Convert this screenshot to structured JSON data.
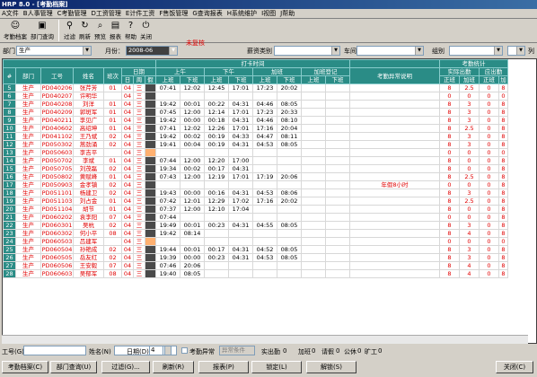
{
  "window": {
    "title": "HRP 8.0 - [考勤档案]"
  },
  "menu": [
    "A文件",
    "B人事管理",
    "C考勤管理",
    "D工资管理",
    "E计件工资",
    "F售饭管理",
    "G查询报表",
    "H系统维护",
    "I视图",
    "J帮助"
  ],
  "toolbar": [
    {
      "label": "考勤档案",
      "icon": "person-icon"
    },
    {
      "label": "部门查询",
      "icon": "computer-icon"
    },
    {
      "label": "过滤",
      "icon": "filter-icon"
    },
    {
      "label": "刷新",
      "icon": "refresh-icon"
    },
    {
      "label": "预览",
      "icon": "preview-icon"
    },
    {
      "label": "报表",
      "icon": "report-icon"
    },
    {
      "label": "帮助",
      "icon": "help-icon"
    },
    {
      "label": "关闭",
      "icon": "close-icon"
    }
  ],
  "status_flag": "未复核",
  "filter": {
    "dept_label": "部门",
    "dept_value": "生产",
    "month_label": "月份：",
    "month_value": "2008-06",
    "pay_type_label": "薪资类别",
    "workshop_label": "车间",
    "group_label": "组别",
    "col_label": "列"
  },
  "headers": {
    "punch": "打卡时间",
    "stats": "考勤统计",
    "num": "#",
    "dept": "部门",
    "emp_no": "工号",
    "name": "姓名",
    "shift": "班次",
    "date": "日期",
    "day": "日",
    "week": "周",
    "holiday": "假",
    "morning": "上午",
    "afternoon": "下午",
    "overtime": "加班",
    "ot_register": "加班登记",
    "abnormal": "考勤异常说明",
    "actual": "实际出勤",
    "due": "应出勤",
    "on_duty": "上班",
    "off_duty": "下班",
    "normal": "正班",
    "ot": "加班",
    "normal2": "正班",
    "ot2": "加"
  },
  "rows": [
    {
      "n": "5",
      "dept": "生产",
      "id": "PD040206",
      "name": "张芹芳",
      "shift": "01",
      "d": "04",
      "w": "三",
      "t": [
        "07:41",
        "12:02",
        "12:45",
        "17:01",
        "17:23",
        "20:02"
      ],
      "note": "",
      "s": [
        "8",
        "2.5",
        "0",
        "8"
      ]
    },
    {
      "n": "6",
      "dept": "生产",
      "id": "PD040207",
      "name": "许明华",
      "shift": "",
      "d": "04",
      "w": "三",
      "t": [
        "",
        "",
        "",
        "",
        "",
        ""
      ],
      "note": "",
      "s": [
        "0",
        "0",
        "0",
        "0"
      ]
    },
    {
      "n": "7",
      "dept": "生产",
      "id": "PD040208",
      "name": "刘洋",
      "shift": "01",
      "d": "04",
      "w": "三",
      "t": [
        "19:42",
        "00:01",
        "00:22",
        "04:31",
        "04:46",
        "08:05"
      ],
      "note": "",
      "s": [
        "8",
        "3",
        "0",
        "8"
      ]
    },
    {
      "n": "8",
      "dept": "生产",
      "id": "PD040209",
      "name": "郭斑军",
      "shift": "01",
      "d": "04",
      "w": "三",
      "t": [
        "07:45",
        "12:00",
        "12:14",
        "17:01",
        "17:23",
        "20:33"
      ],
      "note": "",
      "s": [
        "8",
        "3",
        "0",
        "8"
      ]
    },
    {
      "n": "9",
      "dept": "生产",
      "id": "PD040211",
      "name": "李见广",
      "shift": "01",
      "d": "04",
      "w": "三",
      "t": [
        "19:42",
        "00:00",
        "00:18",
        "04:31",
        "04:46",
        "08:10"
      ],
      "note": "",
      "s": [
        "8",
        "3",
        "0",
        "8"
      ]
    },
    {
      "n": "10",
      "dept": "生产",
      "id": "PD040602",
      "name": "高绍坤",
      "shift": "01",
      "d": "04",
      "w": "三",
      "t": [
        "07:41",
        "12:02",
        "12:26",
        "17:01",
        "17:16",
        "20:04"
      ],
      "note": "",
      "s": [
        "8",
        "2.5",
        "0",
        "8"
      ]
    },
    {
      "n": "11",
      "dept": "生产",
      "id": "PD041102",
      "name": "王乃斌",
      "shift": "02",
      "d": "04",
      "w": "三",
      "t": [
        "19:42",
        "00:02",
        "00:19",
        "04:33",
        "04:47",
        "08:11"
      ],
      "note": "",
      "s": [
        "8",
        "3",
        "0",
        "8"
      ]
    },
    {
      "n": "12",
      "dept": "生产",
      "id": "PD050302",
      "name": "蒿劲涌",
      "shift": "02",
      "d": "04",
      "w": "三",
      "t": [
        "19:41",
        "00:04",
        "00:19",
        "04:31",
        "04:53",
        "08:05"
      ],
      "note": "",
      "s": [
        "8",
        "3",
        "0",
        "8"
      ]
    },
    {
      "n": "13",
      "dept": "生产",
      "id": "PD050603",
      "name": "李吉平",
      "shift": "",
      "d": "04",
      "w": "三",
      "t": [
        "",
        "",
        "",
        "",
        "",
        ""
      ],
      "note": "",
      "s": [
        "0",
        "0",
        "0",
        "0"
      ],
      "orange": true
    },
    {
      "n": "14",
      "dept": "生产",
      "id": "PD050702",
      "name": "李斌",
      "shift": "01",
      "d": "04",
      "w": "三",
      "t": [
        "07:44",
        "12:00",
        "12:20",
        "17:00",
        "",
        ""
      ],
      "note": "",
      "s": [
        "8",
        "0",
        "0",
        "8"
      ]
    },
    {
      "n": "15",
      "dept": "生产",
      "id": "PD050705",
      "name": "刘茂磊",
      "shift": "02",
      "d": "04",
      "w": "三",
      "t": [
        "19:34",
        "00:02",
        "00:17",
        "04:31",
        "",
        ""
      ],
      "note": "",
      "s": [
        "8",
        "0",
        "0",
        "8"
      ]
    },
    {
      "n": "16",
      "dept": "生产",
      "id": "PD050802",
      "name": "黄赋峰",
      "shift": "01",
      "d": "04",
      "w": "三",
      "t": [
        "07:43",
        "12:00",
        "12:19",
        "17:01",
        "17:19",
        "20:06"
      ],
      "note": "",
      "s": [
        "8",
        "2.5",
        "0",
        "8"
      ]
    },
    {
      "n": "17",
      "dept": "生产",
      "id": "PD050903",
      "name": "金孝镇",
      "shift": "02",
      "d": "04",
      "w": "三",
      "t": [
        "",
        "",
        "",
        "",
        "",
        ""
      ],
      "note": "年假8小时",
      "s": [
        "0",
        "0",
        "0",
        "8"
      ]
    },
    {
      "n": "18",
      "dept": "生产",
      "id": "PD051101",
      "name": "杨建卫",
      "shift": "02",
      "d": "04",
      "w": "三",
      "t": [
        "19:43",
        "00:00",
        "00:16",
        "04:31",
        "04:53",
        "08:06"
      ],
      "note": "",
      "s": [
        "8",
        "3",
        "0",
        "8"
      ]
    },
    {
      "n": "19",
      "dept": "生产",
      "id": "PD051103",
      "name": "刘占金",
      "shift": "01",
      "d": "04",
      "w": "三",
      "t": [
        "07:42",
        "12:01",
        "12:29",
        "17:02",
        "17:16",
        "20:02"
      ],
      "note": "",
      "s": [
        "8",
        "2.5",
        "0",
        "8"
      ]
    },
    {
      "n": "20",
      "dept": "生产",
      "id": "PD051104",
      "name": "胡节",
      "shift": "01",
      "d": "04",
      "w": "三",
      "t": [
        "07:37",
        "12:00",
        "12:10",
        "17:04",
        "",
        ""
      ],
      "note": "",
      "s": [
        "8",
        "0",
        "0",
        "8"
      ]
    },
    {
      "n": "21",
      "dept": "生产",
      "id": "PD060202",
      "name": "袁李阳",
      "shift": "07",
      "d": "04",
      "w": "三",
      "t": [
        "07:44",
        "",
        "",
        "",
        "",
        ""
      ],
      "note": "",
      "s": [
        "0",
        "0",
        "0",
        "8"
      ]
    },
    {
      "n": "22",
      "dept": "生产",
      "id": "PD060301",
      "name": "吴杭",
      "shift": "02",
      "d": "04",
      "w": "三",
      "t": [
        "19:49",
        "00:01",
        "00:23",
        "04:31",
        "04:55",
        "08:05"
      ],
      "note": "",
      "s": [
        "8",
        "3",
        "0",
        "8"
      ]
    },
    {
      "n": "23",
      "dept": "生产",
      "id": "PD060302",
      "name": "何小平",
      "shift": "08",
      "d": "04",
      "w": "三",
      "t": [
        "19:42",
        "08:14",
        "",
        "",
        "",
        ""
      ],
      "note": "",
      "s": [
        "8",
        "4",
        "0",
        "8"
      ]
    },
    {
      "n": "24",
      "dept": "生产",
      "id": "PD060503",
      "name": "吕建军",
      "shift": "",
      "d": "04",
      "w": "三",
      "t": [
        "",
        "",
        "",
        "",
        "",
        ""
      ],
      "note": "",
      "s": [
        "0",
        "0",
        "0",
        "0"
      ],
      "orange": true
    },
    {
      "n": "25",
      "dept": "生产",
      "id": "PD060504",
      "name": "孙艳成",
      "shift": "02",
      "d": "04",
      "w": "三",
      "t": [
        "19:44",
        "00:01",
        "00:17",
        "04:31",
        "04:52",
        "08:05"
      ],
      "note": "",
      "s": [
        "8",
        "3",
        "0",
        "8"
      ]
    },
    {
      "n": "26",
      "dept": "生产",
      "id": "PD060505",
      "name": "岳友红",
      "shift": "02",
      "d": "04",
      "w": "三",
      "t": [
        "19:39",
        "00:00",
        "00:23",
        "04:31",
        "04:53",
        "08:05"
      ],
      "note": "",
      "s": [
        "8",
        "3",
        "0",
        "8"
      ]
    },
    {
      "n": "27",
      "dept": "生产",
      "id": "PD060506",
      "name": "王安毅",
      "shift": "07",
      "d": "04",
      "w": "三",
      "t": [
        "07:46",
        "20:06",
        "",
        "",
        "",
        ""
      ],
      "note": "",
      "s": [
        "8",
        "4",
        "0",
        "8"
      ]
    },
    {
      "n": "28",
      "dept": "生产",
      "id": "PD060603",
      "name": "吴郁军",
      "shift": "08",
      "d": "04",
      "w": "三",
      "t": [
        "19:40",
        "08:05",
        "",
        "",
        "",
        ""
      ],
      "note": "",
      "s": [
        "8",
        "4",
        "0",
        "8"
      ]
    }
  ],
  "statusbar": {
    "emp_no_label": "工号(G)",
    "name_label": "姓名(N)",
    "date_label": "日期(D)",
    "date_value": "4",
    "abnormal_label": "考勤异常",
    "abnormal_cond": "异常条件",
    "actual_label": "实出勤",
    "actual_value": "0",
    "ot_label": "加班",
    "ot_value": "0",
    "leave_label": "请假",
    "leave_value": "0",
    "public_label": "公休",
    "public_value": "0",
    "absent_label": "旷工",
    "absent_value": "0"
  },
  "buttons": {
    "archive": "考勤档案(C)",
    "dept_query": "部门查询(U)",
    "filter": "过滤(G)...",
    "refresh": "刷新(R)",
    "report": "报表(P)",
    "lock": "锁定(L)",
    "unlock": "解锁(S)",
    "close": "关闭(C)"
  }
}
